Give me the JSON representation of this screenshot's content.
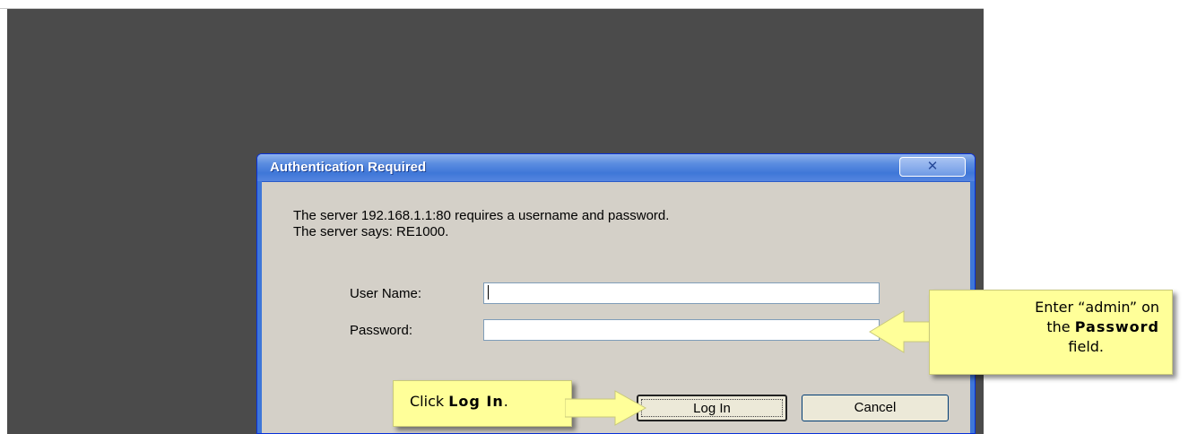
{
  "dialog": {
    "title": "Authentication Required",
    "close_glyph": "✕",
    "message_line1": "The server 192.168.1.1:80 requires a username and password.",
    "message_line2": "The server says: RE1000.",
    "username_label": "User Name:",
    "username_value": "",
    "password_label": "Password:",
    "password_value": "",
    "login_label": "Log In",
    "cancel_label": "Cancel"
  },
  "callouts": {
    "password_line1": "Enter “admin” on",
    "password_line2_prefix": "the ",
    "password_line2_bold": "Password",
    "password_line3": "field.",
    "login_prefix": "Click ",
    "login_bold": "Log In",
    "login_suffix": "."
  },
  "colors": {
    "backdrop": "#4b4b4b",
    "dialog_bg": "#d4d0c8",
    "titlebar": "#3f77d8",
    "callout_bg": "#ffff99"
  }
}
